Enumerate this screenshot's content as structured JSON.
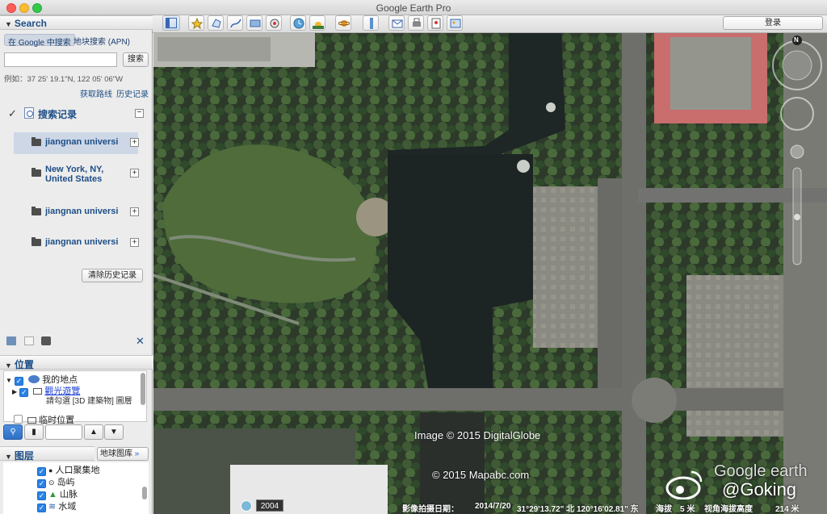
{
  "window": {
    "title": "Google Earth Pro"
  },
  "search": {
    "section_title": "Search",
    "tab_google": "在 Google 中搜索",
    "tab_parcel": "地块搜索 (APN)",
    "input_value": "",
    "search_button": "搜索",
    "example": "例如：37 25' 19.1\"N, 122 05' 06\"W",
    "link_directions": "获取路线",
    "link_history": "历史记录"
  },
  "history": {
    "title": "搜索记录",
    "items": [
      {
        "label": "jiangnan universi",
        "selected": true
      },
      {
        "label": "New York, NY, United States",
        "selected": false
      },
      {
        "label": "jiangnan universi",
        "selected": false
      },
      {
        "label": "jiangnan universi",
        "selected": false
      }
    ],
    "clear_button": "清除历史记录"
  },
  "places": {
    "section_title": "位置",
    "my_places": "我的地点",
    "sightseeing": "觀光遊覽",
    "sightseeing_note": "請勾選 [3D 建築物] 圖層",
    "temp_places": "临时位置"
  },
  "layers": {
    "section_title": "图层",
    "library_button": "地球图库",
    "items": [
      {
        "label": "人口聚集地",
        "icon": "dot-icon"
      },
      {
        "label": "岛屿",
        "icon": "island-icon"
      },
      {
        "label": "山脉",
        "icon": "mountain-icon"
      },
      {
        "label": "水域",
        "icon": "water-icon"
      }
    ]
  },
  "toolbar": {
    "login_button": "登录"
  },
  "map": {
    "copyright_image": "Image © 2015 DigitalGlobe",
    "copyright_map": "© 2015 Mapabc.com",
    "year": "2004",
    "status_date_label": "影像拍摄日期：",
    "status_date": "2014/7/20",
    "status_coords": "31°29'13.72\" 北  120°16'02.81\" 东",
    "status_alt_label": "海拔",
    "status_alt": "5 米",
    "status_eye_label": "视角海拔高度",
    "status_eye": "214 米",
    "compass_north": "N",
    "watermark_logo": "Google earth",
    "watermark_id": "@Goking"
  },
  "colors": {
    "link": "#1d4e86",
    "selected": "#cdd7e6",
    "checkbox": "#2a82e6"
  }
}
